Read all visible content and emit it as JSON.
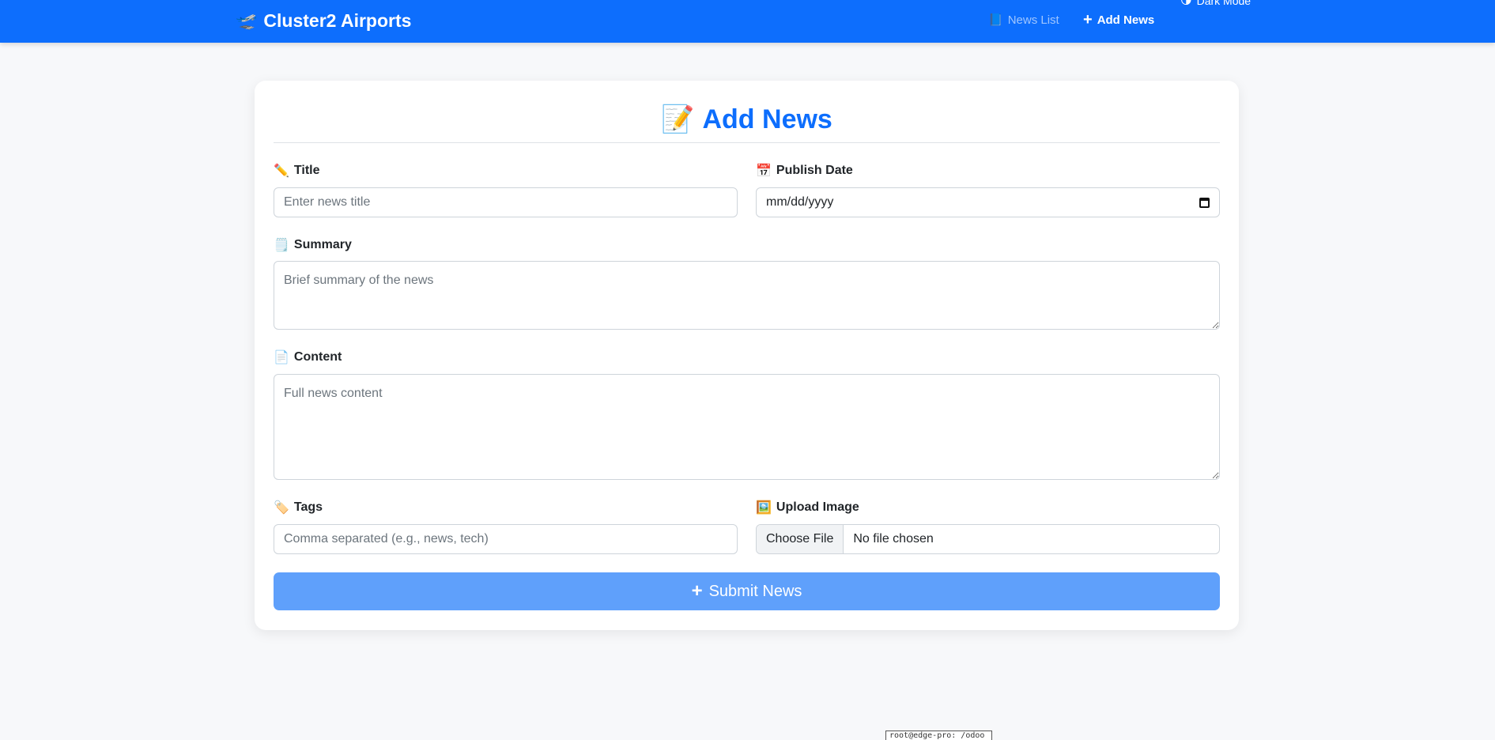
{
  "navbar": {
    "brand_icon": "🛫",
    "brand_label": "Cluster2 Airports",
    "links": [
      {
        "icon": "📘",
        "label": "News List"
      },
      {
        "icon": "+",
        "label": "Add News"
      },
      {
        "icon": "🌗",
        "label": "Dark Mode"
      }
    ]
  },
  "form": {
    "heading_icon": "📝",
    "heading": "Add News",
    "title": {
      "icon": "✏️",
      "label": "Title",
      "placeholder": "Enter news title"
    },
    "publish_date": {
      "icon": "📅",
      "label": "Publish Date",
      "value": "mm/dd/yyyy"
    },
    "summary": {
      "icon": "🗒️",
      "label": "Summary",
      "placeholder": "Brief summary of the news"
    },
    "content": {
      "icon": "📄",
      "label": "Content",
      "placeholder": "Full news content"
    },
    "tags": {
      "icon": "🏷️",
      "label": "Tags",
      "placeholder": "Comma separated (e.g., news, tech)"
    },
    "upload_image": {
      "icon": "🖼️",
      "label": "Upload Image",
      "button": "Choose File",
      "status": "No file chosen"
    },
    "submit": {
      "icon": "+",
      "label": "Submit News"
    }
  },
  "tooltip": "root@edge-pro: /odoo"
}
